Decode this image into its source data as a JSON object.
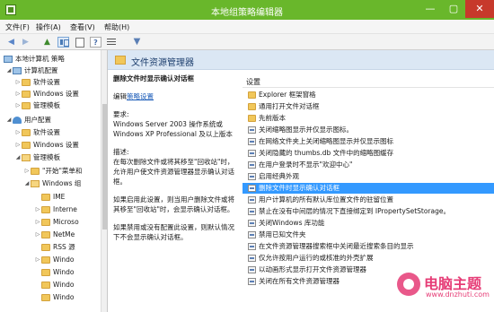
{
  "window": {
    "title": "本地组策略编辑器",
    "min_glyph": "—",
    "max_glyph": "▢",
    "close_glyph": "✕"
  },
  "menu": [
    "文件(F)",
    "操作(A)",
    "查看(V)",
    "帮助(H)"
  ],
  "toolbar": {
    "back_glyph": "◀",
    "forward_glyph": "▶",
    "up_glyph": "▲",
    "help_glyph": "?",
    "filter_glyph": "▼"
  },
  "tree": {
    "expanded_glyph": "◢",
    "collapsed_glyph": "▷",
    "items": [
      {
        "label": "本地计算机 策略",
        "icon": "policy-icon"
      },
      {
        "label": "计算机配置",
        "icon": "computer-icon"
      },
      {
        "label": "软件设置",
        "icon": "folder-icon"
      },
      {
        "label": "Windows 设置",
        "icon": "folder-icon"
      },
      {
        "label": "管理模板",
        "icon": "folder-icon"
      },
      {
        "label": "用户配置",
        "icon": "user-icon"
      },
      {
        "label": "软件设置",
        "icon": "folder-icon"
      },
      {
        "label": "Windows 设置",
        "icon": "folder-icon"
      },
      {
        "label": "管理模板",
        "icon": "folder-icon"
      },
      {
        "label": "\"开始\"菜单和",
        "icon": "folder-icon"
      },
      {
        "label": "Windows 组",
        "icon": "folder-icon"
      },
      {
        "label": "IME",
        "icon": "folder-icon"
      },
      {
        "label": "Interne",
        "icon": "folder-icon"
      },
      {
        "label": "Microso",
        "icon": "folder-icon"
      },
      {
        "label": "NetMe",
        "icon": "folder-icon"
      },
      {
        "label": "RSS 源",
        "icon": "folder-icon"
      },
      {
        "label": "Windo",
        "icon": "folder-icon"
      },
      {
        "label": "Windo",
        "icon": "folder-icon"
      },
      {
        "label": "Windo",
        "icon": "folder-icon"
      },
      {
        "label": "Windo",
        "icon": "folder-icon"
      },
      {
        "label": "Windo",
        "icon": "folder-icon"
      },
      {
        "label": "Windo",
        "icon": "folder-icon"
      }
    ]
  },
  "header": {
    "title": "文件资源管理器"
  },
  "description": {
    "policy_name": "删除文件时显示确认对话框",
    "edit_prefix": "编辑",
    "edit_link": "策略设置",
    "requirements_label": "要求:",
    "requirements_1": "Windows Server 2003 操作系统或",
    "requirements_2": "Windows XP Professional 及以上版本",
    "desc_label": "描述:",
    "desc_text": "在每次删除文件或将其移至\"回收站\"时，允许用户使文件资源管理器显示确认对话框。",
    "enabled_text": "如果启用此设置，则当用户删除文件或将其移至\"回收站\"时，会显示确认对话框。",
    "disabled_text": "如果禁用或没有配置此设置，则默认情况下不会显示确认对话框。"
  },
  "settings": {
    "column_header": "设置",
    "rows": [
      {
        "label": "Explorer 框架窗格",
        "icon": "folder-icon"
      },
      {
        "label": "通用打开文件对话框",
        "icon": "folder-icon"
      },
      {
        "label": "先前版本",
        "icon": "folder-icon"
      },
      {
        "label": "关闭缩略图显示并仅显示图标。",
        "icon": "policy-icon"
      },
      {
        "label": "在网络文件夹上关闭缩略图显示并仅显示图标",
        "icon": "policy-icon"
      },
      {
        "label": "关闭隐藏的 thumbs.db 文件中的缩略图缓存",
        "icon": "policy-icon"
      },
      {
        "label": "在用户登录时不显示\"欢迎中心\"",
        "icon": "policy-icon"
      },
      {
        "label": "启用经典外观",
        "icon": "policy-icon"
      },
      {
        "label": "删除文件时显示确认对话框",
        "icon": "policy-icon",
        "selected": true
      },
      {
        "label": "用户计算机的所有默认库位置文件的驻留位置",
        "icon": "policy-icon"
      },
      {
        "label": "禁止在没有中间层的情况下直接绑定到 IPropertySetStorage。",
        "icon": "policy-icon"
      },
      {
        "label": "关闭Windows 库功能",
        "icon": "policy-icon"
      },
      {
        "label": "禁用已知文件夹",
        "icon": "policy-icon"
      },
      {
        "label": "在文件资源管理器搜索框中关闭最近搜索条目的显示",
        "icon": "policy-icon"
      },
      {
        "label": "仅允许按用户运行的或核准的外壳扩展",
        "icon": "policy-icon"
      },
      {
        "label": "以动画形式显示打开文件资源管理器",
        "icon": "policy-icon"
      },
      {
        "label": "关闭在所有文件资源管理器",
        "icon": "policy-icon"
      }
    ]
  },
  "watermark": {
    "brand": "电脑主题",
    "url": "www.dnzhuti.com"
  },
  "colors": {
    "titlebar": "#69b72b",
    "selection": "#3399ff",
    "header_band": "#dbe7f4",
    "watermark": "#e63c76"
  }
}
